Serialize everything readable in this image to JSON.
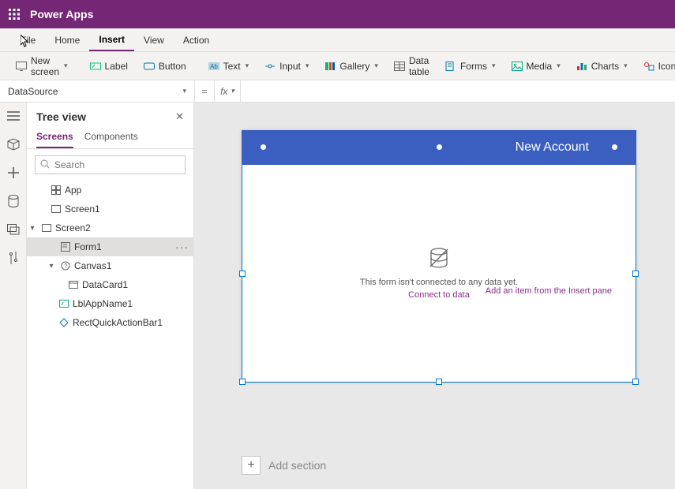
{
  "app_title": "Power Apps",
  "menu": {
    "file": "File",
    "home": "Home",
    "insert": "Insert",
    "view": "View",
    "action": "Action"
  },
  "ribbon": {
    "new_screen": "New screen",
    "label": "Label",
    "button": "Button",
    "text": "Text",
    "input": "Input",
    "gallery": "Gallery",
    "data_table": "Data table",
    "forms": "Forms",
    "media": "Media",
    "charts": "Charts",
    "icons": "Icons"
  },
  "formula": {
    "property": "DataSource",
    "eq": "=",
    "fx": "fx",
    "value": ""
  },
  "sidebar": {
    "title": "Tree view",
    "tabs": {
      "screens": "Screens",
      "components": "Components"
    },
    "search_placeholder": "Search",
    "tree": {
      "app": "App",
      "screen1": "Screen1",
      "screen2": "Screen2",
      "form1": "Form1",
      "canvas1": "Canvas1",
      "datacard1": "DataCard1",
      "lblappname": "LblAppName1",
      "rectquick": "RectQuickActionBar1"
    }
  },
  "canvas": {
    "header": "New Account",
    "empty_msg": "This form isn't connected to any data yet.",
    "connect_link": "Connect to data",
    "add_item_link": "Add an item from the Insert pane",
    "add_section": "Add section"
  }
}
